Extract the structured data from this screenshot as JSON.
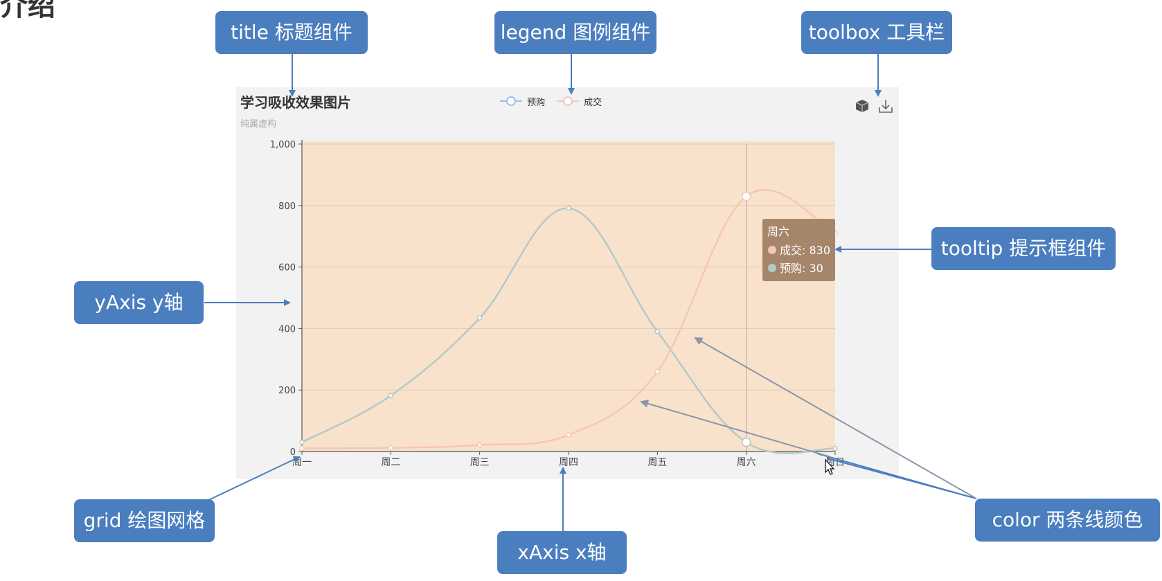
{
  "slide": {
    "heading_fragment": "介绍"
  },
  "annotations": {
    "title": "title 标题组件",
    "legend": "legend 图例组件",
    "toolbox": "toolbox 工具栏",
    "tooltip": "tooltip 提示框组件",
    "yaxis": "yAxis y轴",
    "grid": "grid 绘图网格",
    "xaxis": "xAxis x轴",
    "color": "color 两条线颜色"
  },
  "colors": {
    "annotation_box": "#4a7ebf",
    "panel_bg": "#f2f2f2",
    "grid_bg": "#f9e2cc",
    "series_yugou": "#b5c9c8",
    "series_chengjiao": "#f6c7b3",
    "tooltip_bg": "#a6866a",
    "legend_yugou": "#9ec0ea",
    "legend_chengjiao": "#f2c4c4"
  },
  "toolbox": {
    "icons": [
      "data-view-icon",
      "download-icon"
    ]
  },
  "chart_data": {
    "type": "line",
    "title": "学习吸收效果图片",
    "subtitle": "纯属虚构",
    "categories": [
      "周一",
      "周二",
      "周三",
      "周四",
      "周五",
      "周六",
      "周日"
    ],
    "yticks": [
      "0",
      "200",
      "400",
      "600",
      "800",
      "1,000"
    ],
    "ylim": [
      0,
      1000
    ],
    "smooth": true,
    "grid": true,
    "legend_position": "top-center",
    "series": [
      {
        "name": "预购",
        "values": [
          30,
          182,
          434,
          791,
          390,
          30,
          10
        ]
      },
      {
        "name": "成交",
        "values": [
          10,
          12,
          21,
          54,
          260,
          830,
          710
        ]
      }
    ],
    "tooltip": {
      "category": "周六",
      "lines": [
        "成交: 830",
        "预购: 30"
      ]
    }
  }
}
